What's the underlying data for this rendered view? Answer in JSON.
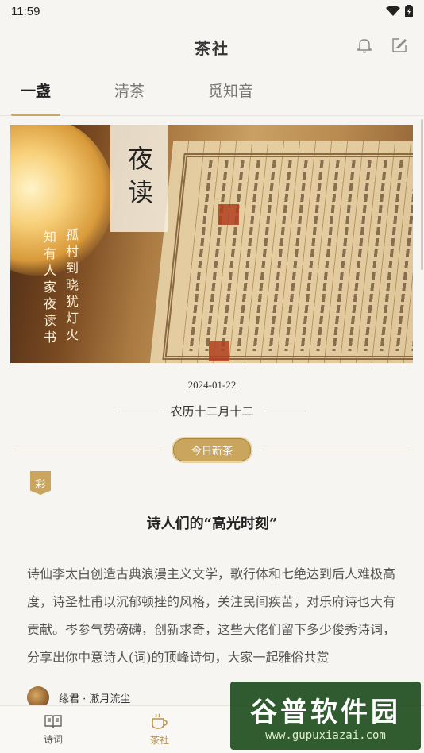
{
  "status_bar": {
    "time": "11:59"
  },
  "header": {
    "title": "茶社",
    "icons": [
      "bell-icon",
      "edit-icon"
    ]
  },
  "tabs": [
    {
      "label": "一盏",
      "active": true
    },
    {
      "label": "清茶",
      "active": false
    },
    {
      "label": "觅知音",
      "active": false
    }
  ],
  "banner": {
    "title": "夜读",
    "poem_lines": [
      "孤村到晓犹灯火",
      "知有人家夜读书"
    ]
  },
  "date": {
    "solar": "2024-01-22",
    "lunar": "农历十二月十二"
  },
  "section_badge": "今日新茶",
  "post": {
    "tag": "彩",
    "title": "诗人们的“高光时刻”",
    "body": "诗仙李太白创造古典浪漫主义文学，歌行体和七绝达到后人难极高度，诗圣杜甫以沉郁顿挫的风格，关注民间疾苦，对乐府诗也大有贡献。岑参气势磅礴，创新求奇，这些大佬们留下多少俊秀诗词，",
    "body_2": "分享出你中意诗人(词)的顶峰诗句，大家一起雅俗共赏",
    "author": "缘君 · 澈月流尘"
  },
  "bottom_nav": [
    {
      "label": "诗词",
      "icon": "book-icon",
      "active": false
    },
    {
      "label": "茶社",
      "icon": "tea-cup-icon",
      "active": true
    }
  ],
  "watermark": {
    "main": "谷普软件园",
    "url": "www.gupuxiazai.com"
  },
  "colors": {
    "accent": "#c9a55e",
    "background": "#f7f5f2"
  }
}
